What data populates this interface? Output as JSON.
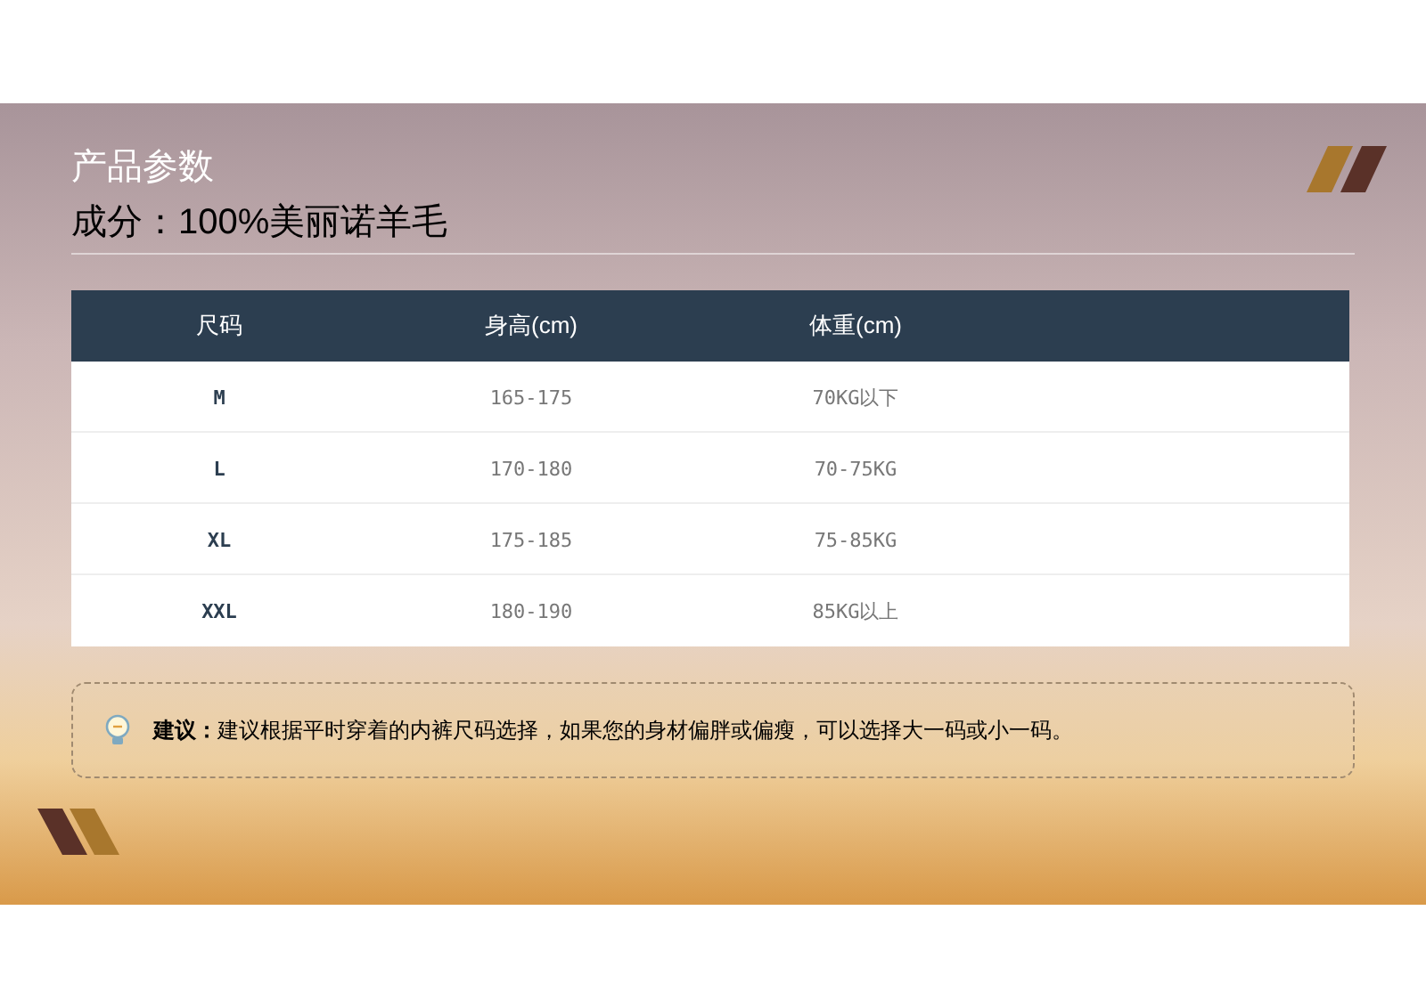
{
  "heading": "产品参数",
  "subheading": "成分：100%美丽诺羊毛",
  "table": {
    "columns": [
      "尺码",
      "身高(cm)",
      "体重(cm)"
    ],
    "rows": [
      [
        "M",
        "165-175",
        "70KG以下"
      ],
      [
        "L",
        "170-180",
        "70-75KG"
      ],
      [
        "XL",
        "175-185",
        "75-85KG"
      ],
      [
        "XXL",
        "180-190",
        "85KG以上"
      ]
    ]
  },
  "tip": "**建议：**建议根据平时穿着的内裤尺码选择，如果您的身材偏胖或偏瘦，可以选择大一码或小一码。"
}
